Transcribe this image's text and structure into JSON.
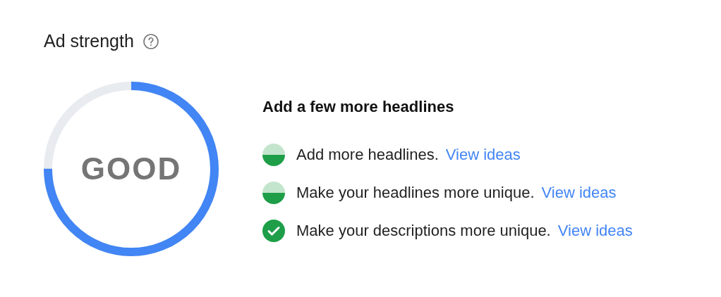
{
  "title": "Ad strength",
  "gauge": {
    "label": "GOOD",
    "level": 0.75
  },
  "suggestions": {
    "heading": "Add a few more headlines",
    "items": [
      {
        "kind": "partial",
        "text": "Add more headlines.",
        "link": "View ideas"
      },
      {
        "kind": "partial",
        "text": "Make your headlines more unique.",
        "link": "View ideas"
      },
      {
        "kind": "done",
        "text": "Make your descriptions more unique.",
        "link": "View ideas"
      }
    ]
  }
}
